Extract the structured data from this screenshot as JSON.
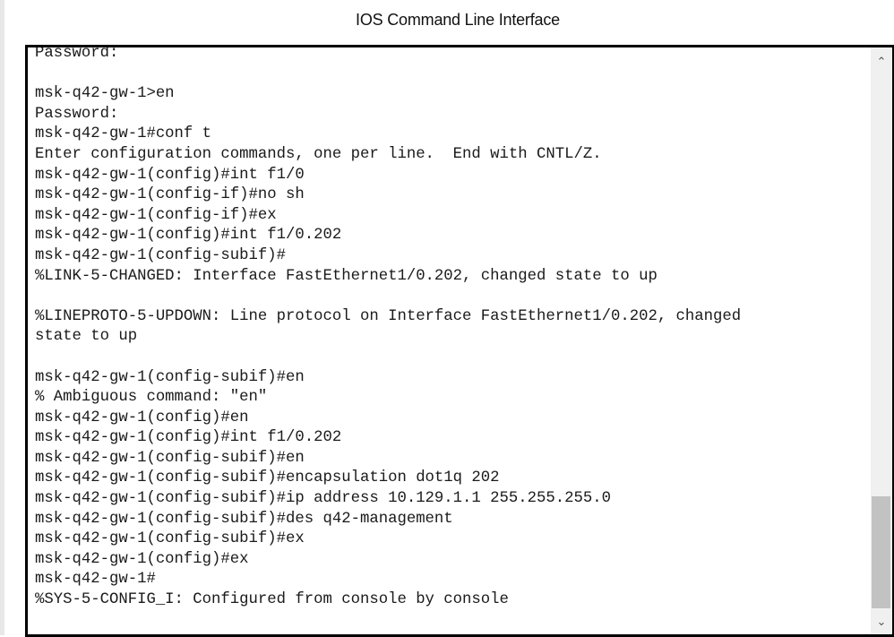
{
  "window": {
    "title": "IOS Command Line Interface"
  },
  "terminal": {
    "lines": [
      "Password:",
      "",
      "msk-q42-gw-1>en",
      "Password:",
      "msk-q42-gw-1#conf t",
      "Enter configuration commands, one per line.  End with CNTL/Z.",
      "msk-q42-gw-1(config)#int f1/0",
      "msk-q42-gw-1(config-if)#no sh",
      "msk-q42-gw-1(config-if)#ex",
      "msk-q42-gw-1(config)#int f1/0.202",
      "msk-q42-gw-1(config-subif)#",
      "%LINK-5-CHANGED: Interface FastEthernet1/0.202, changed state to up",
      "",
      "%LINEPROTO-5-UPDOWN: Line protocol on Interface FastEthernet1/0.202, changed",
      "state to up",
      "",
      "msk-q42-gw-1(config-subif)#en",
      "% Ambiguous command: \"en\"",
      "msk-q42-gw-1(config)#en",
      "msk-q42-gw-1(config)#int f1/0.202",
      "msk-q42-gw-1(config-subif)#en",
      "msk-q42-gw-1(config-subif)#encapsulation dot1q 202",
      "msk-q42-gw-1(config-subif)#ip address 10.129.1.1 255.255.255.0",
      "msk-q42-gw-1(config-subif)#des q42-management",
      "msk-q42-gw-1(config-subif)#ex",
      "msk-q42-gw-1(config)#ex",
      "msk-q42-gw-1#",
      "%SYS-5-CONFIG_I: Configured from console by console"
    ]
  },
  "scrollbar": {
    "up_icon": "⌃",
    "down_icon": "⌄"
  }
}
